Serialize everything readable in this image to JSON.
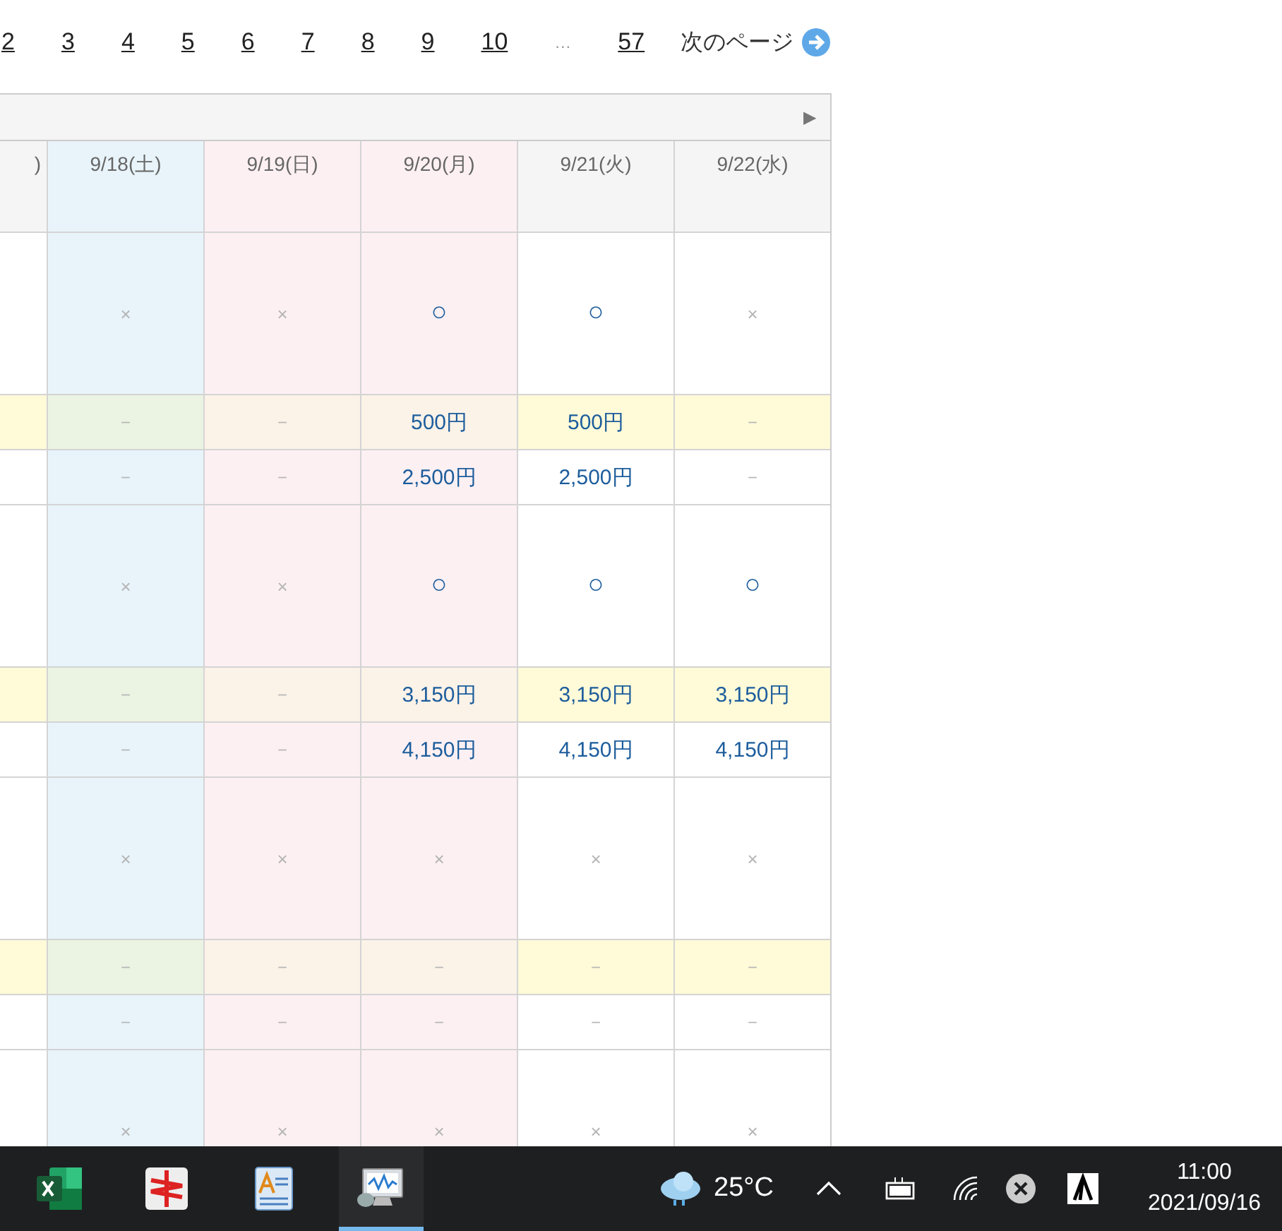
{
  "pagination": {
    "pages": [
      {
        "label": "2"
      },
      {
        "label": "3"
      },
      {
        "label": "4"
      },
      {
        "label": "5"
      },
      {
        "label": "6"
      },
      {
        "label": "7"
      },
      {
        "label": "8"
      },
      {
        "label": "9"
      },
      {
        "label": "10"
      }
    ],
    "ellipsis": "…",
    "last_page": "57",
    "next": "次のページ"
  },
  "table": {
    "scroll_arrow": "▶",
    "columns": [
      {
        "label": ")",
        "kind": "weekday"
      },
      {
        "label": "9/18(土)",
        "kind": "saturday"
      },
      {
        "label": "9/19(日)",
        "kind": "holiday"
      },
      {
        "label": "9/20(月)",
        "kind": "holiday"
      },
      {
        "label": "9/21(火)",
        "kind": "weekday"
      },
      {
        "label": "9/22(水)",
        "kind": "weekday"
      }
    ],
    "rows": [
      {
        "kind": "availability",
        "shaded": false,
        "cells": [
          "",
          "×",
          "×",
          "○",
          "○",
          "×"
        ]
      },
      {
        "kind": "price",
        "shaded": true,
        "cells": [
          "",
          "－",
          "－",
          "500円",
          "500円",
          "－"
        ]
      },
      {
        "kind": "price",
        "shaded": false,
        "cells": [
          "",
          "－",
          "－",
          "2,500円",
          "2,500円",
          "－"
        ]
      },
      {
        "kind": "availability",
        "shaded": false,
        "cells": [
          "",
          "×",
          "×",
          "○",
          "○",
          "○"
        ]
      },
      {
        "kind": "price",
        "shaded": true,
        "cells": [
          "",
          "－",
          "－",
          "3,150円",
          "3,150円",
          "3,150円"
        ]
      },
      {
        "kind": "price",
        "shaded": false,
        "cells": [
          "",
          "－",
          "－",
          "4,150円",
          "4,150円",
          "4,150円"
        ]
      },
      {
        "kind": "availability",
        "shaded": false,
        "cells": [
          "",
          "×",
          "×",
          "×",
          "×",
          "×"
        ]
      },
      {
        "kind": "price",
        "shaded": true,
        "cells": [
          "",
          "－",
          "－",
          "－",
          "－",
          "－"
        ]
      },
      {
        "kind": "price",
        "shaded": false,
        "cells": [
          "",
          "－",
          "－",
          "－",
          "－",
          "－"
        ]
      },
      {
        "kind": "availability",
        "shaded": false,
        "cells": [
          "",
          "×",
          "×",
          "×",
          "×",
          "×"
        ]
      }
    ]
  },
  "taskbar": {
    "apps": [
      {
        "kind": "spreadsheet",
        "selected": false
      },
      {
        "kind": "red-app",
        "selected": false
      },
      {
        "kind": "document",
        "selected": false
      },
      {
        "kind": "monitor",
        "selected": true
      }
    ],
    "weather": "25°C",
    "time": "11:00",
    "date": "2021/09/16"
  }
}
